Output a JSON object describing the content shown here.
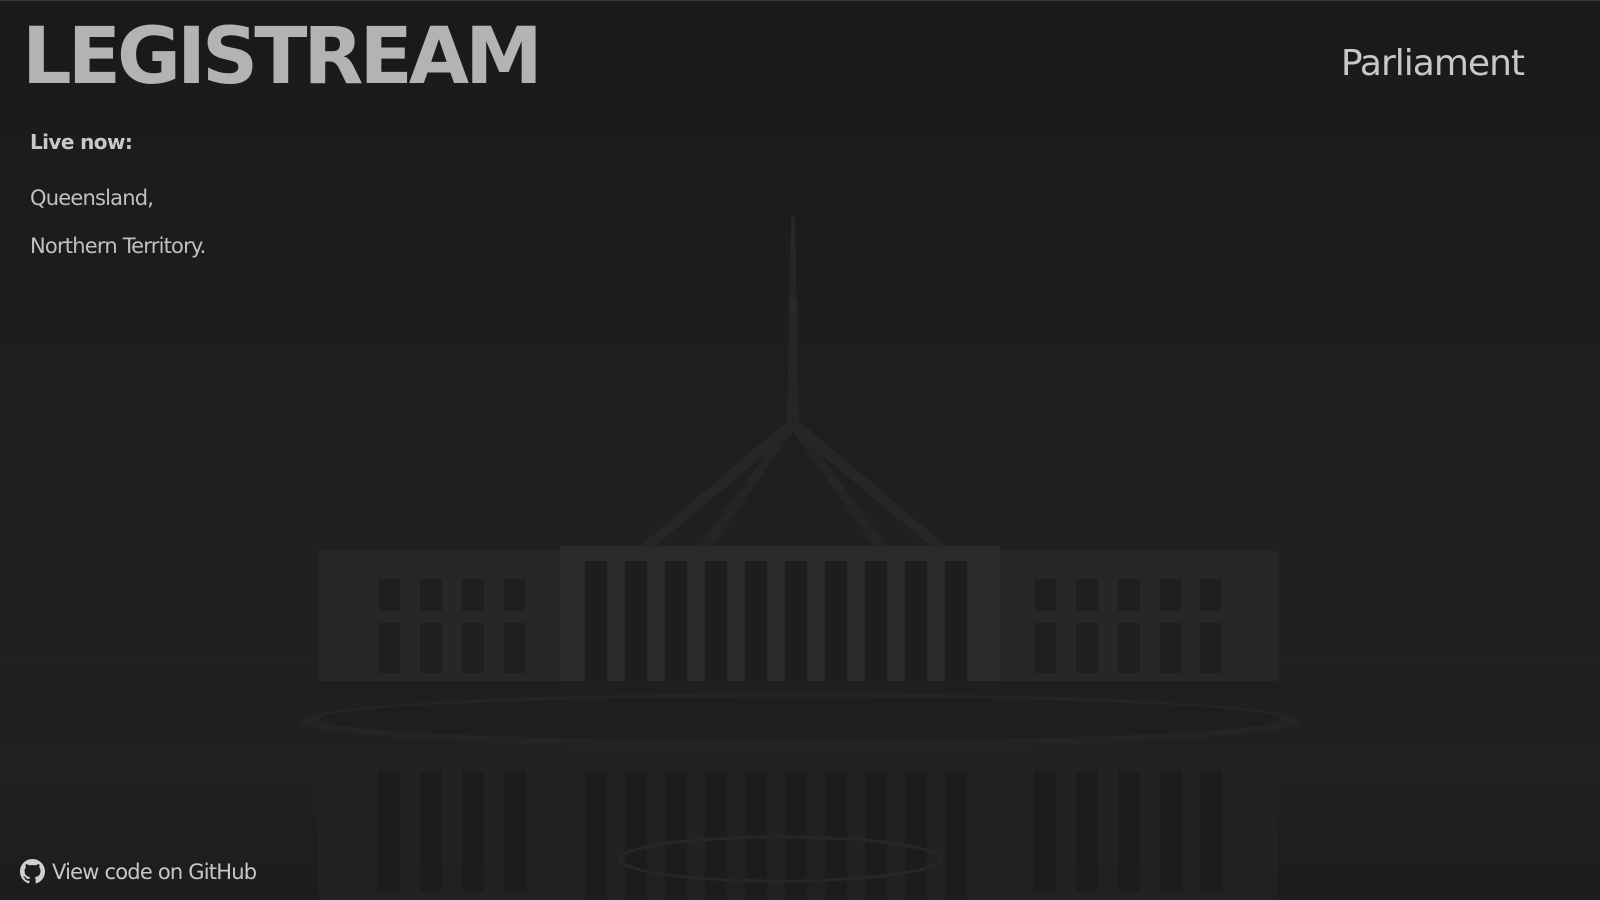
{
  "header": {
    "logo": "LEGISTREAM",
    "nav_link": "Parliament"
  },
  "live": {
    "heading": "Live now:",
    "items": [
      {
        "label": "Queensland,"
      },
      {
        "label": "Northern Territory."
      }
    ]
  },
  "footer": {
    "github_label": "View code on GitHub",
    "github_icon": "github-octocat-icon"
  },
  "background": {
    "subject": "parliament-house-photo",
    "overlay_color": "#1b1b1b"
  }
}
